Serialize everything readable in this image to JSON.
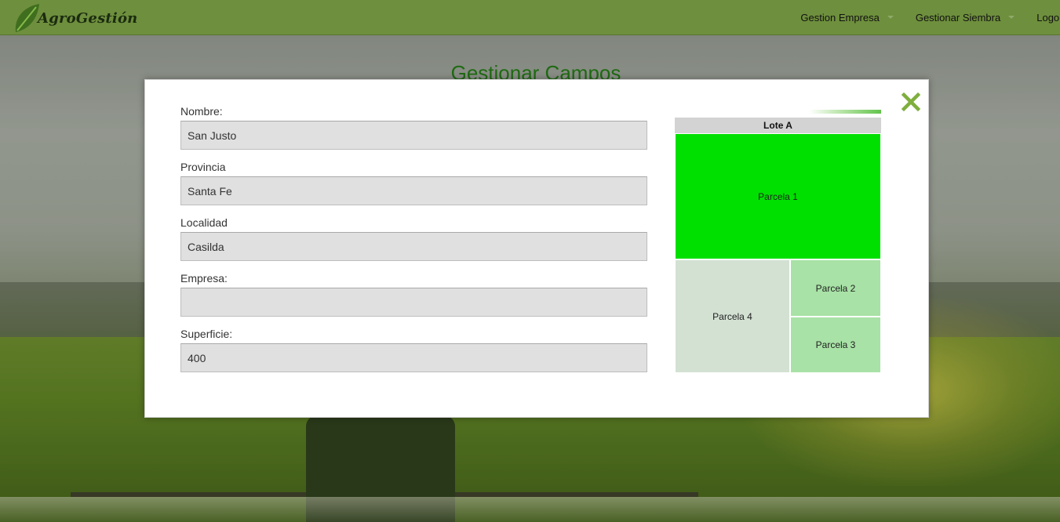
{
  "app": {
    "brand": "AgroGestión",
    "accent_color": "#6e8f3d"
  },
  "nav": {
    "items": [
      {
        "label": "Gestion Empresa",
        "icon": "caret-down-icon"
      },
      {
        "label": "Gestionar Siembra",
        "icon": "caret-down-icon"
      },
      {
        "label": "Logout"
      }
    ]
  },
  "page": {
    "title": "Gestionar Campos"
  },
  "modal": {
    "close_icon": "close-icon",
    "form": {
      "fields": [
        {
          "label": "Nombre:",
          "value": "San Justo"
        },
        {
          "label": "Provincia",
          "value": "Santa Fe"
        },
        {
          "label": "Localidad",
          "value": "Casilda"
        },
        {
          "label": "Empresa:",
          "value": ""
        },
        {
          "label": "Superficie:",
          "value": "400"
        }
      ]
    },
    "treemap": {
      "title": "Lote A",
      "cells": [
        {
          "label": "Parcela 1",
          "color": "#00e000"
        },
        {
          "label": "Parcela 4",
          "color": "#d3e1d3"
        },
        {
          "label": "Parcela 2",
          "color": "#a8e2a6"
        },
        {
          "label": "Parcela 3",
          "color": "#a8e2a6"
        }
      ]
    }
  }
}
